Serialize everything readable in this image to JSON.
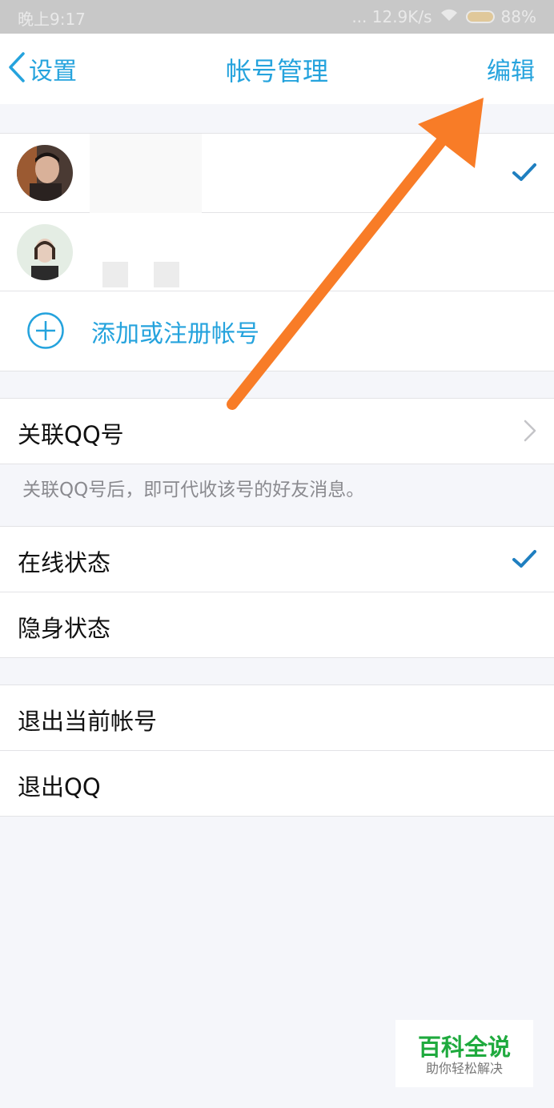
{
  "status_bar": {
    "time": "晚上9:17",
    "network": "... 12.9K/s",
    "battery": "88%"
  },
  "nav": {
    "back_label": "设置",
    "title": "帐号管理",
    "edit_label": "编辑"
  },
  "accounts": {
    "add_label": "添加或注册帐号"
  },
  "linked": {
    "label": "关联QQ号",
    "hint": "关联QQ号后，即可代收该号的好友消息。"
  },
  "status_options": {
    "online": "在线状态",
    "invisible": "隐身状态"
  },
  "exit": {
    "logout_current": "退出当前帐号",
    "quit_qq": "退出QQ"
  },
  "watermark": {
    "title": "百科全说",
    "subtitle": "助你轻松解决"
  },
  "colors": {
    "accent": "#25a3dd",
    "checkmark": "#1f7fc0",
    "arrow": "#f87c27"
  }
}
